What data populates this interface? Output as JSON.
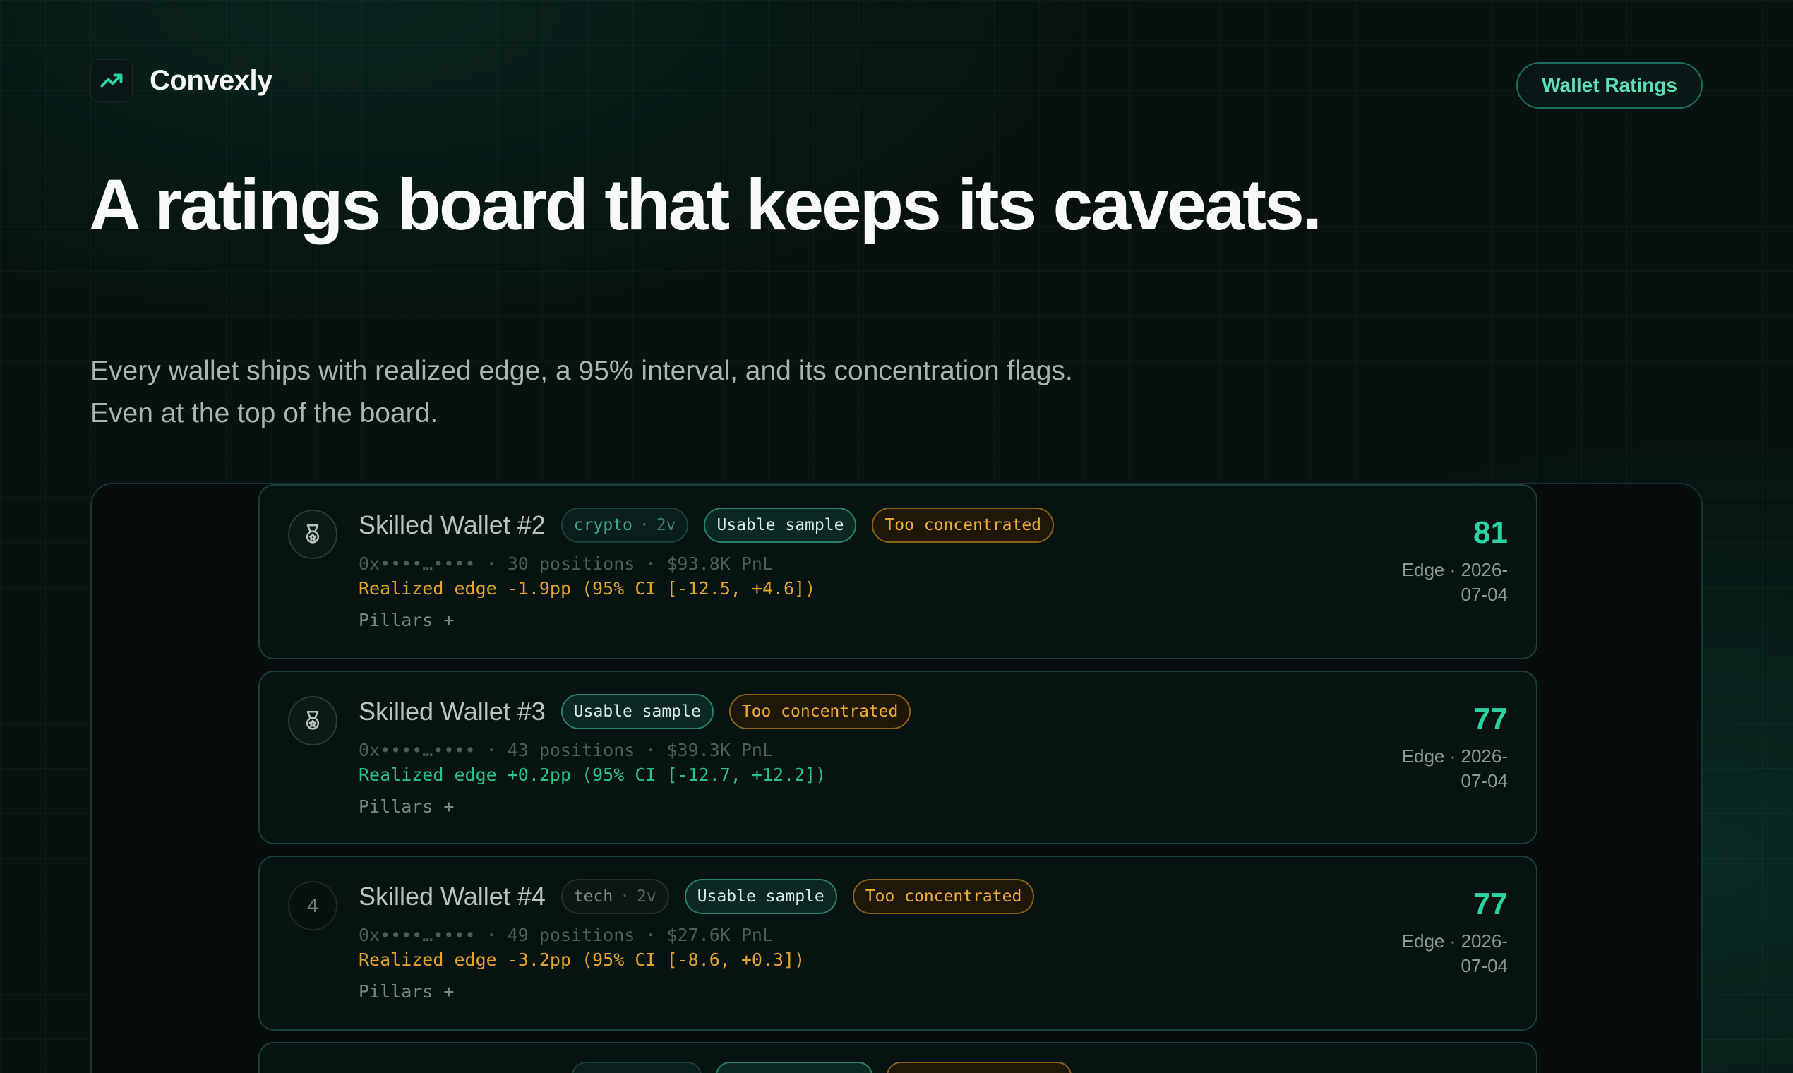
{
  "brand": {
    "name": "Convexly",
    "logo_icon": "trending-up-icon",
    "accent": "#2bd3a0"
  },
  "nav": {
    "pill_label": "Wallet Ratings"
  },
  "hero": {
    "title": "A ratings board that keeps its caveats.",
    "subtitle_line1": "Every wallet ships with realized edge, a 95% interval, and its concentration flags.",
    "subtitle_line2": "Even at the top of the board."
  },
  "wallets": [
    {
      "rank_icon": "medal-icon",
      "name": "Skilled Wallet #2",
      "category": "crypto",
      "category_sub": "2v",
      "sample_tag": "Usable sample",
      "concentration_tag": "Too concentrated",
      "meta": "0x••••…•••• · 30 positions · $93.8K PnL",
      "edge_text": "Realized edge -1.9pp (95% CI [-12.5, +4.6])",
      "edge_sign": "negative",
      "pillars_label": "Pillars +",
      "score": "81",
      "score_label_1": "Edge · 2026-",
      "score_label_2": "07-04"
    },
    {
      "rank_icon": "medal-icon",
      "name": "Skilled Wallet #3",
      "sample_tag": "Usable sample",
      "concentration_tag": "Too concentrated",
      "meta": "0x••••…•••• · 43 positions · $39.3K PnL",
      "edge_text": "Realized edge +0.2pp (95% CI [-12.7, +12.2])",
      "edge_sign": "positive",
      "pillars_label": "Pillars +",
      "score": "77",
      "score_label_1": "Edge · 2026-",
      "score_label_2": "07-04"
    },
    {
      "rank": "4",
      "name": "Skilled Wallet #4",
      "category": "tech",
      "category_sub": "2v",
      "sample_tag": "Usable sample",
      "concentration_tag": "Too concentrated",
      "meta": "0x••••…•••• · 49 positions · $27.6K PnL",
      "edge_text": "Realized edge -3.2pp (95% CI [-8.6, +0.3])",
      "edge_sign": "negative",
      "pillars_label": "Pillars +",
      "score": "77",
      "score_label_1": "Edge · 2026-",
      "score_label_2": "07-04"
    }
  ]
}
